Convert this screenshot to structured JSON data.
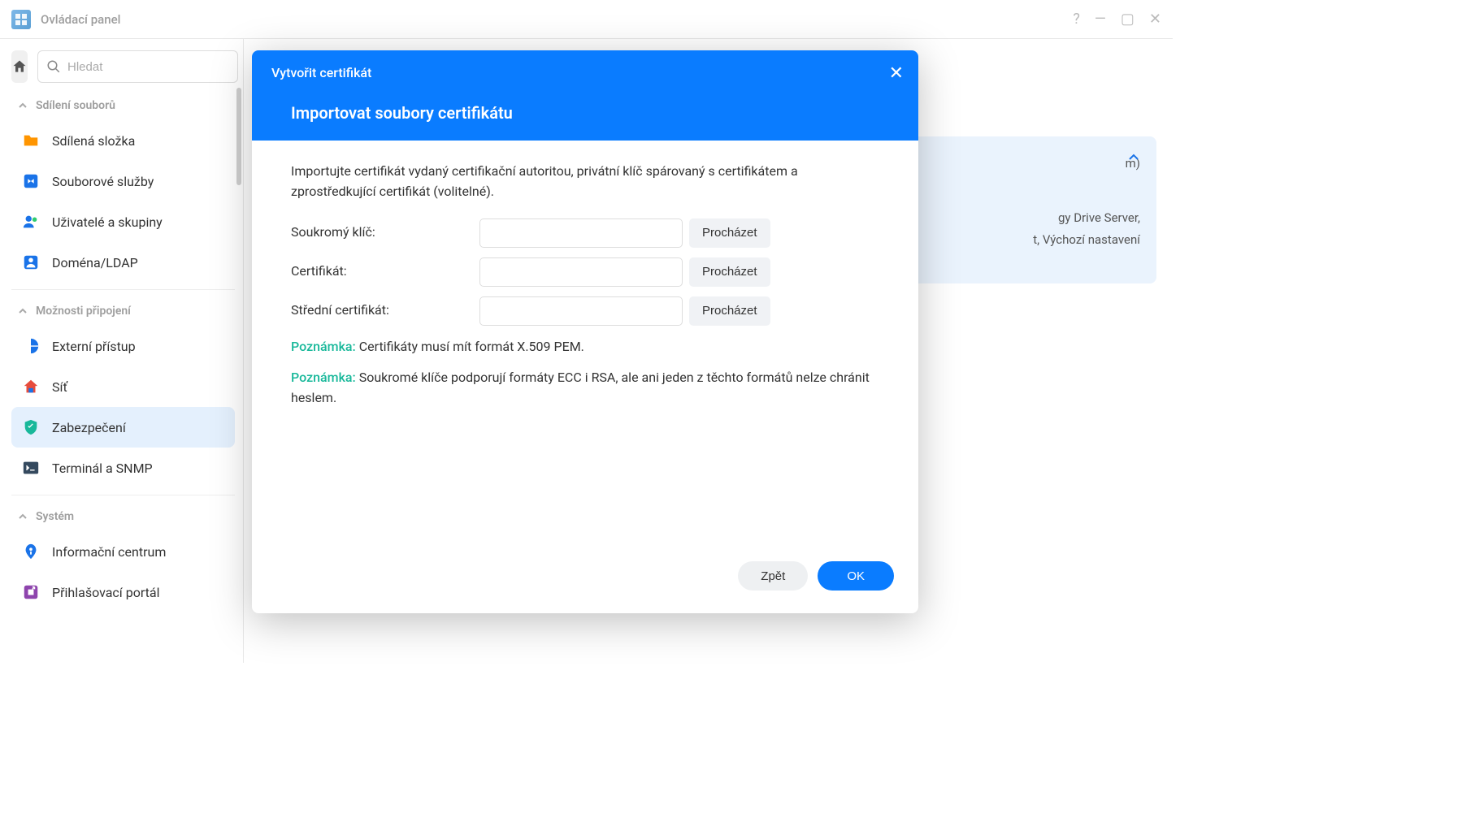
{
  "window": {
    "title": "Ovládací panel"
  },
  "search": {
    "placeholder": "Hledat"
  },
  "sections": {
    "file_sharing": {
      "label": "Sdílení souborů"
    },
    "connectivity": {
      "label": "Možnosti připojení"
    },
    "system": {
      "label": "Systém"
    }
  },
  "sidebar": {
    "shared_folder": "Sdílená složka",
    "file_services": "Souborové služby",
    "users_groups": "Uživatelé a skupiny",
    "domain_ldap": "Doména/LDAP",
    "external_access": "Externí přístup",
    "network": "Síť",
    "security": "Zabezpečení",
    "terminal": "Terminál a SNMP",
    "info_center": "Informační centrum",
    "login_portal": "Přihlašovací portál"
  },
  "cert_panel": {
    "line1_fragment": "gy Drive Server,",
    "line2_fragment": "t, Výchozí nastavení",
    "line0_fragment": "m)"
  },
  "modal": {
    "title": "Vytvořit certifikát",
    "subtitle": "Importovat soubory certifikátu",
    "intro": "Importujte certifikát vydaný certifikační autoritou, privátní klíč spárovaný s certifikátem a zprostředkující certifikát (volitelné).",
    "labels": {
      "private_key": "Soukromý klíč:",
      "certificate": "Certifikát:",
      "intermediate": "Střední certifikát:"
    },
    "browse": "Procházet",
    "note_label": "Poznámka:",
    "note1": " Certifikáty musí mít formát X.509 PEM.",
    "note2": " Soukromé klíče podporují formáty ECC i RSA, ale ani jeden z těchto formátů nelze chránit heslem.",
    "back": "Zpět",
    "ok": "OK"
  }
}
